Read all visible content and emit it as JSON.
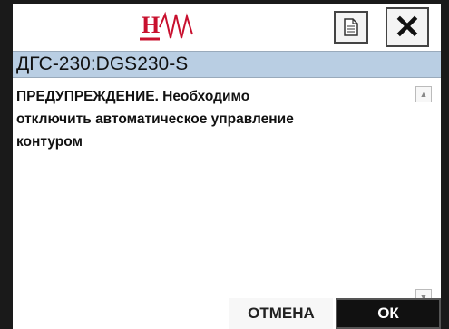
{
  "header": {
    "logo_letter": "H",
    "logo_icon": "waveform-logo",
    "document_icon": "document-icon",
    "close_glyph": "✕"
  },
  "titlebar": {
    "title": "ДГС-230:DGS230-S"
  },
  "message": {
    "text": "ПРЕДУПРЕЖДЕНИЕ. Необходимо\nотключить автоматическое управление\nконтуром"
  },
  "scroll": {
    "up_glyph": "▲",
    "down_glyph": "▼"
  },
  "footer": {
    "cancel_label": "ОТМЕНА",
    "ok_label": "ОК"
  },
  "colors": {
    "logo_red": "#c8102e",
    "titlebar_bg": "#b9cee3",
    "ok_bg": "#111111"
  }
}
